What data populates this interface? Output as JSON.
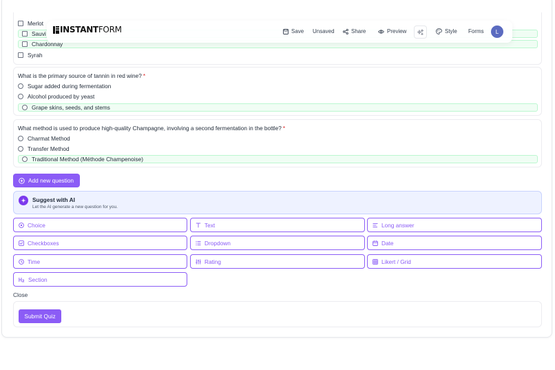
{
  "app": {
    "logo_bold": "INSTANT",
    "logo_rest": "FORM",
    "accent_color": "#8b5cf6",
    "correct_bg": "#f0fdf4"
  },
  "toolbar": {
    "save_label": "Save",
    "unsaved_label": "Unsaved",
    "share_label": "Share",
    "preview_label": "Preview",
    "style_label": "Style",
    "forms_label": "Forms",
    "avatar_initial": "L"
  },
  "questions": [
    {
      "type": "checkboxes",
      "options": [
        {
          "label": "Merlot",
          "correct": false
        },
        {
          "label": "Sauvi",
          "correct": true
        },
        {
          "label": "Chardonnay",
          "correct": true
        },
        {
          "label": "Syrah",
          "correct": false
        }
      ]
    },
    {
      "type": "choice",
      "title": "What is the primary source of tannin in red wine?",
      "required_mark": "*",
      "options": [
        {
          "label": "Sugar added during fermentation",
          "correct": false
        },
        {
          "label": "Alcohol produced by yeast",
          "correct": false
        },
        {
          "label": "Grape skins, seeds, and stems",
          "correct": true
        }
      ]
    },
    {
      "type": "choice",
      "title": "What method is used to produce high-quality Champagne, involving a second fermentation in the bottle?",
      "required_mark": "*",
      "options": [
        {
          "label": "Charmat Method",
          "correct": false
        },
        {
          "label": "Transfer Method",
          "correct": false
        },
        {
          "label": "Traditional Method (Méthode Champenoise)",
          "correct": true
        }
      ]
    }
  ],
  "add_question_label": "Add new question",
  "ai_suggest": {
    "title": "Suggest with AI",
    "subtitle": "Let the AI generate a new question for you."
  },
  "question_types": [
    {
      "label": "Choice",
      "icon": "radio-icon"
    },
    {
      "label": "Text",
      "icon": "text-icon"
    },
    {
      "label": "Long answer",
      "icon": "long-answer-icon"
    },
    {
      "label": "Checkboxes",
      "icon": "checkbox-icon"
    },
    {
      "label": "Dropdown",
      "icon": "dropdown-icon"
    },
    {
      "label": "Date",
      "icon": "calendar-icon"
    },
    {
      "label": "Time",
      "icon": "clock-icon"
    },
    {
      "label": "Rating",
      "icon": "rating-icon"
    },
    {
      "label": "Likert / Grid",
      "icon": "grid-icon"
    },
    {
      "label": "Section",
      "icon": "heading-icon"
    }
  ],
  "close_label": "Close",
  "submit_label": "Submit Quiz"
}
